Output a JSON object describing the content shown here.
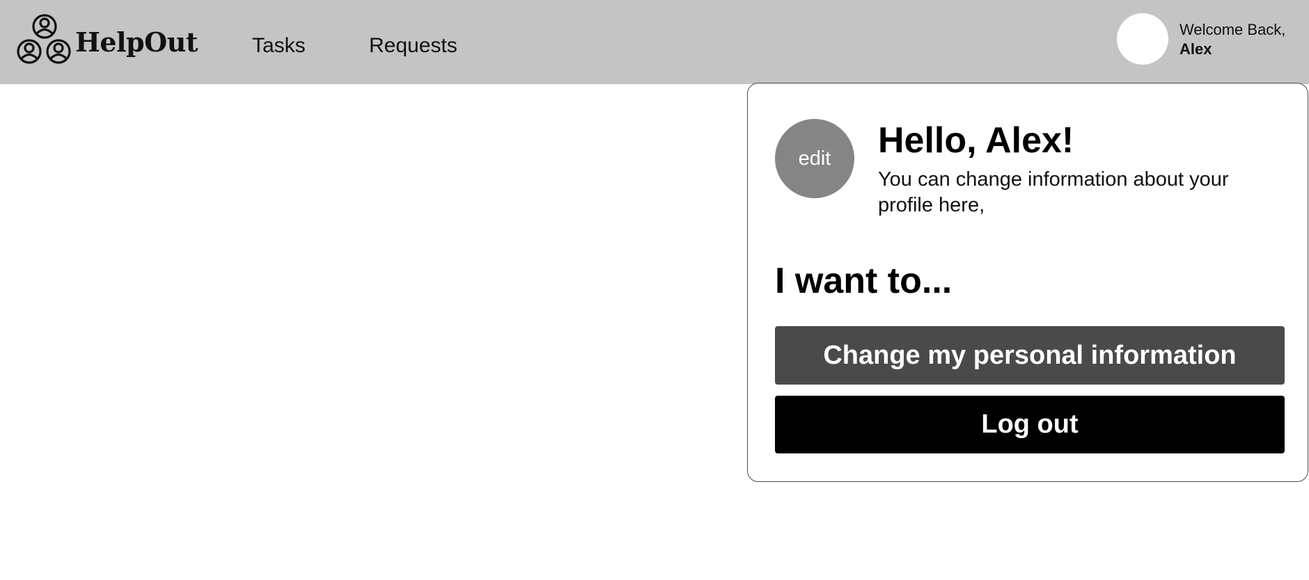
{
  "header": {
    "brand": "HelpOut",
    "nav": [
      {
        "label": "Tasks"
      },
      {
        "label": "Requests"
      }
    ],
    "welcome_line": "Welcome Back,",
    "user_name": "Alex"
  },
  "profile_menu": {
    "avatar_label": "edit",
    "greeting": "Hello, Alex!",
    "description": "You can change information about your profile here,",
    "prompt": "I want to...",
    "actions": {
      "change_info": "Change my personal information",
      "logout": "Log out"
    }
  },
  "colors": {
    "header_bg": "#c4c4c4",
    "avatar_placeholder": "#858585",
    "primary_button": "#4a4a4a",
    "logout_button": "#000000"
  },
  "icons": {
    "logo": "three-people-icon"
  }
}
